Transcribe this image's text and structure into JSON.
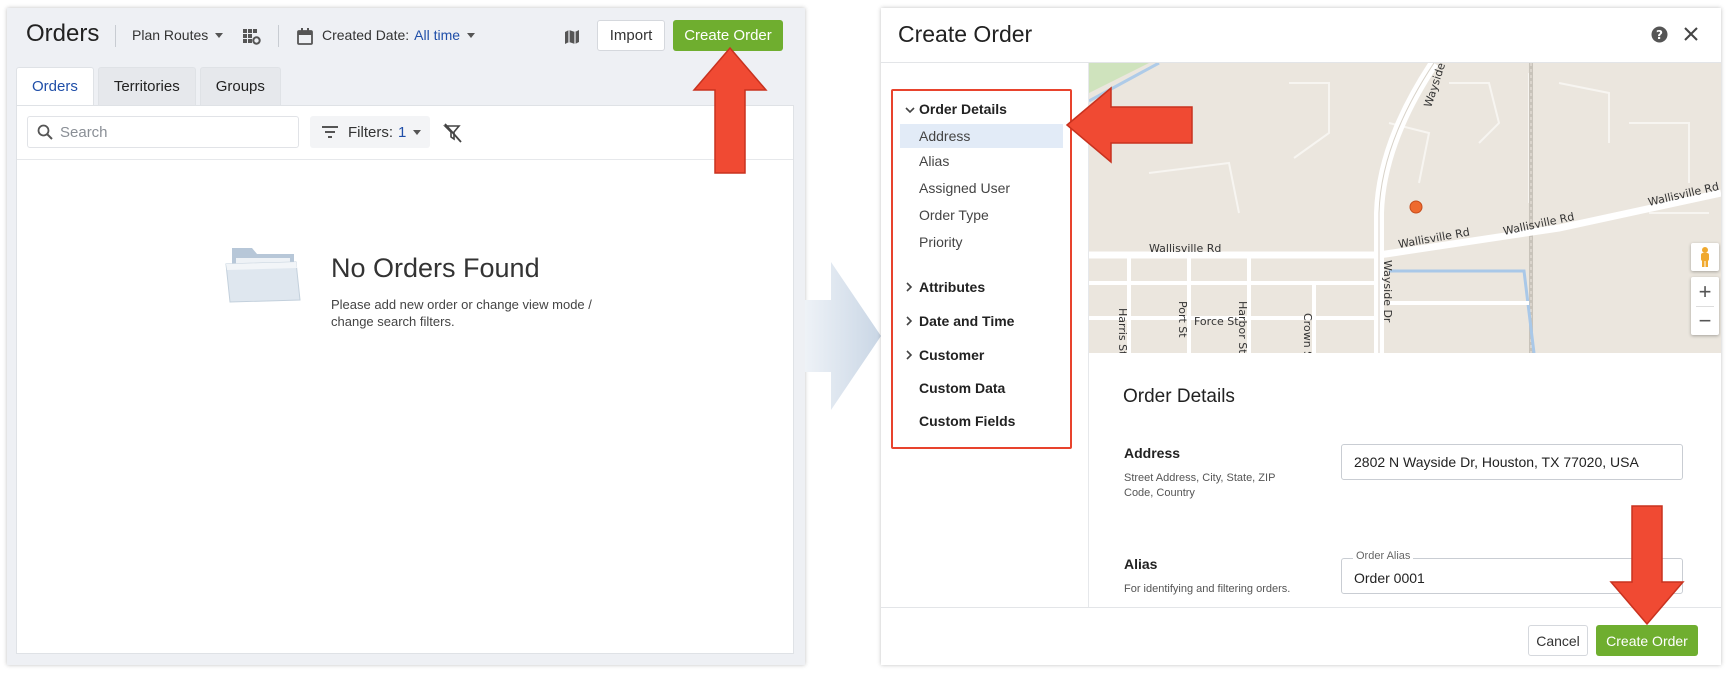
{
  "left": {
    "title": "Orders",
    "plan_routes": "Plan Routes",
    "created_date_label": "Created Date:",
    "created_date_value": "All time",
    "import_label": "Import",
    "create_order_label": "Create Order",
    "tabs": [
      {
        "label": "Orders"
      },
      {
        "label": "Territories"
      },
      {
        "label": "Groups"
      }
    ],
    "search_placeholder": "Search",
    "filters_label": "Filters:",
    "filters_count": "1",
    "empty_title": "No Orders Found",
    "empty_desc": "Please add new order or change view mode / change search filters."
  },
  "modal": {
    "title": "Create Order",
    "nav": {
      "order_details": "Order Details",
      "sub_items": [
        "Address",
        "Alias",
        "Assigned User",
        "Order Type",
        "Priority"
      ],
      "attributes": "Attributes",
      "date_time": "Date and Time",
      "customer": "Customer",
      "custom_data": "Custom Data",
      "custom_fields": "Custom Fields"
    },
    "map": {
      "streets": [
        "Wallisville Rd",
        "Wallisville Rd",
        "Wallisville Rd",
        "Wallisville Rd",
        "Wayside",
        "Wayside Dr",
        "Harris St",
        "Port St",
        "Harbor St",
        "Crown St",
        "Force St"
      ]
    },
    "form": {
      "section_title": "Order Details",
      "address_label": "Address",
      "address_desc": "Street Address, City, State, ZIP Code, Country",
      "address_value": "2802 N Wayside Dr, Houston, TX 77020, USA",
      "alias_label": "Alias",
      "alias_desc": "For identifying and filtering orders.",
      "alias_field_label": "Order Alias",
      "alias_value": "Order 0001"
    },
    "cancel_label": "Cancel",
    "create_label": "Create Order"
  },
  "colors": {
    "accent_green": "#6fae2f",
    "highlight_red": "#e8432d",
    "link_blue": "#1f4ea8"
  }
}
